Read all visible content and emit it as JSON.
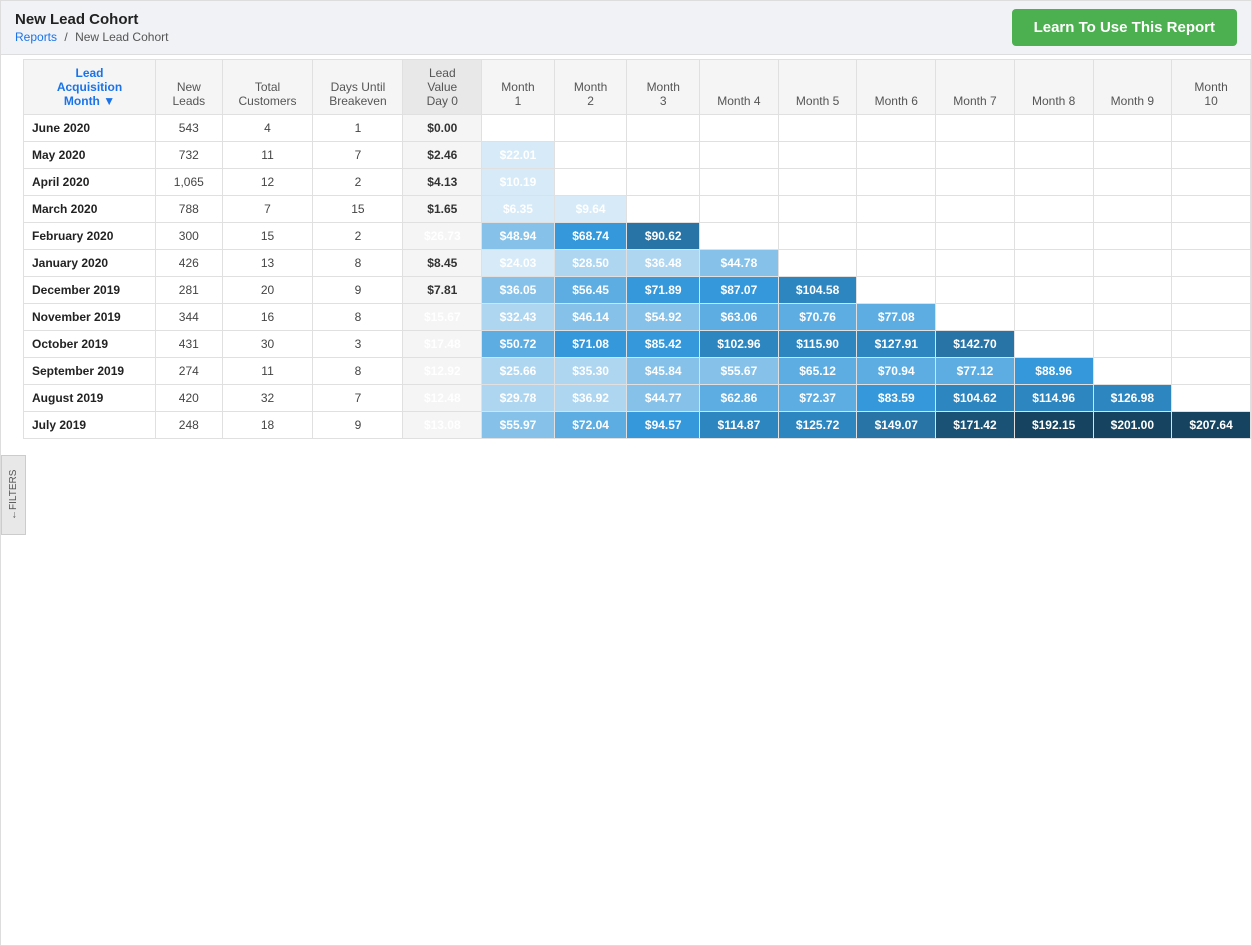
{
  "header": {
    "title": "New Lead Cohort",
    "breadcrumb_parent": "Reports",
    "breadcrumb_sep": "/",
    "breadcrumb_current": "New Lead Cohort",
    "learn_btn": "Learn To Use This Report"
  },
  "filters_label": "FILTERS",
  "table": {
    "columns": [
      {
        "key": "lead_acq",
        "label": "Lead Acquisition Month ▼",
        "class": "lead-acq"
      },
      {
        "key": "new_leads",
        "label": "New Leads"
      },
      {
        "key": "total_customers",
        "label": "Total Customers"
      },
      {
        "key": "days_until",
        "label": "Days Until Breakeven"
      },
      {
        "key": "day0",
        "label": "Lead Value Day 0"
      },
      {
        "key": "m1",
        "label": "Month 1"
      },
      {
        "key": "m2",
        "label": "Month 2"
      },
      {
        "key": "m3",
        "label": "Month 3"
      },
      {
        "key": "m4",
        "label": "Month 4"
      },
      {
        "key": "m5",
        "label": "Month 5"
      },
      {
        "key": "m6",
        "label": "Month 6"
      },
      {
        "key": "m7",
        "label": "Month 7"
      },
      {
        "key": "m8",
        "label": "Month 8"
      },
      {
        "key": "m9",
        "label": "Month 9"
      },
      {
        "key": "m10",
        "label": "Month 10"
      }
    ],
    "rows": [
      {
        "label": "June 2020",
        "new_leads": "543",
        "total_customers": "4",
        "days_until": "1",
        "day0": "$0.00",
        "months": [
          null,
          null,
          null,
          null,
          null,
          null,
          null,
          null,
          null,
          null
        ]
      },
      {
        "label": "May 2020",
        "new_leads": "732",
        "total_customers": "11",
        "days_until": "7",
        "day0": "$2.46",
        "months": [
          "$22.01",
          null,
          null,
          null,
          null,
          null,
          null,
          null,
          null,
          null
        ]
      },
      {
        "label": "April 2020",
        "new_leads": "1,065",
        "total_customers": "12",
        "days_until": "2",
        "day0": "$4.13",
        "months": [
          "$10.19",
          null,
          null,
          null,
          null,
          null,
          null,
          null,
          null,
          null
        ]
      },
      {
        "label": "March 2020",
        "new_leads": "788",
        "total_customers": "7",
        "days_until": "15",
        "day0": "$1.65",
        "months": [
          "$6.35",
          "$9.64",
          null,
          null,
          null,
          null,
          null,
          null,
          null,
          null
        ]
      },
      {
        "label": "February 2020",
        "new_leads": "300",
        "total_customers": "15",
        "days_until": "2",
        "day0": "$26.73",
        "months": [
          "$48.94",
          "$68.74",
          "$90.62",
          null,
          null,
          null,
          null,
          null,
          null,
          null
        ]
      },
      {
        "label": "January 2020",
        "new_leads": "426",
        "total_customers": "13",
        "days_until": "8",
        "day0": "$8.45",
        "months": [
          "$24.03",
          "$28.50",
          "$36.48",
          "$44.78",
          null,
          null,
          null,
          null,
          null,
          null
        ]
      },
      {
        "label": "December 2019",
        "new_leads": "281",
        "total_customers": "20",
        "days_until": "9",
        "day0": "$7.81",
        "months": [
          "$36.05",
          "$56.45",
          "$71.89",
          "$87.07",
          "$104.58",
          null,
          null,
          null,
          null,
          null
        ]
      },
      {
        "label": "November 2019",
        "new_leads": "344",
        "total_customers": "16",
        "days_until": "8",
        "day0": "$15.67",
        "months": [
          "$32.43",
          "$46.14",
          "$54.92",
          "$63.06",
          "$70.76",
          "$77.08",
          null,
          null,
          null,
          null
        ]
      },
      {
        "label": "October 2019",
        "new_leads": "431",
        "total_customers": "30",
        "days_until": "3",
        "day0": "$17.48",
        "months": [
          "$50.72",
          "$71.08",
          "$85.42",
          "$102.96",
          "$115.90",
          "$127.91",
          "$142.70",
          null,
          null,
          null
        ]
      },
      {
        "label": "September 2019",
        "new_leads": "274",
        "total_customers": "11",
        "days_until": "8",
        "day0": "$12.92",
        "months": [
          "$25.66",
          "$35.30",
          "$45.84",
          "$55.67",
          "$65.12",
          "$70.94",
          "$77.12",
          "$88.96",
          null,
          null
        ]
      },
      {
        "label": "August 2019",
        "new_leads": "420",
        "total_customers": "32",
        "days_until": "7",
        "day0": "$12.48",
        "months": [
          "$29.78",
          "$36.92",
          "$44.77",
          "$62.86",
          "$72.37",
          "$83.59",
          "$104.62",
          "$114.96",
          "$126.98",
          null
        ]
      },
      {
        "label": "July 2019",
        "new_leads": "248",
        "total_customers": "18",
        "days_until": "9",
        "day0": "$13.08",
        "months": [
          "$55.97",
          "$72.04",
          "$94.57",
          "$114.87",
          "$125.72",
          "$149.07",
          "$171.42",
          "$192.15",
          "$201.00",
          "$207.64"
        ]
      }
    ]
  }
}
